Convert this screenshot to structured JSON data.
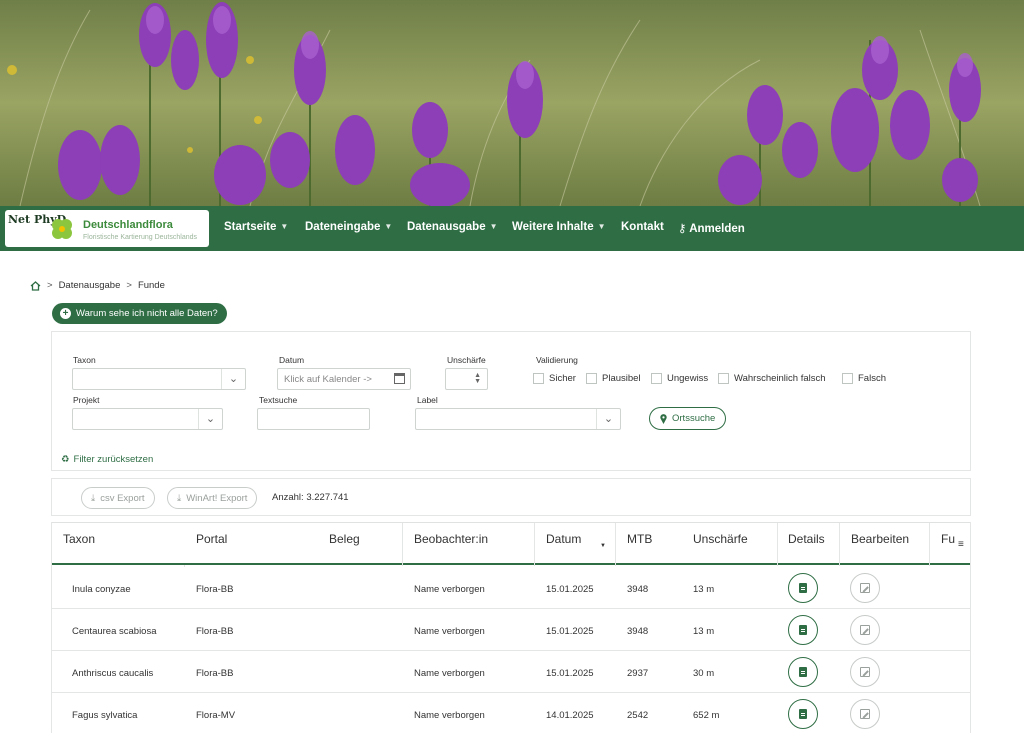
{
  "brand": {
    "badge": "Net PhyD",
    "title": "Deutschlandflora",
    "subtitle": "Floristische Kartierung Deutschlands"
  },
  "nav": {
    "items": [
      {
        "label": "Startseite"
      },
      {
        "label": "Dateneingabe"
      },
      {
        "label": "Datenausgabe"
      },
      {
        "label": "Weitere Inhalte"
      },
      {
        "label": "Kontakt"
      },
      {
        "label": "Anmelden"
      }
    ]
  },
  "breadcrumb": {
    "items": [
      "Datenausgabe",
      "Funde"
    ]
  },
  "why_button": "Warum sehe ich nicht alle Daten?",
  "filters": {
    "taxon_label": "Taxon",
    "datum_label": "Datum",
    "datum_placeholder": "Klick auf Kalender ->",
    "unschaerfe_label": "Unschärfe",
    "validierung_label": "Validierung",
    "validierung_options": [
      "Sicher",
      "Plausibel",
      "Ungewiss",
      "Wahrscheinlich falsch",
      "Falsch"
    ],
    "projekt_label": "Projekt",
    "textsuche_label": "Textsuche",
    "label_label": "Label",
    "ortssuche_button": "Ortssuche",
    "reset": "Filter zurücksetzen"
  },
  "export": {
    "csv": "csv Export",
    "winart": "WinArt! Export",
    "count": "Anzahl: 3.227.741"
  },
  "table": {
    "headers": [
      "Taxon",
      "Portal",
      "Beleg",
      "Beobachter:in",
      "Datum",
      "MTB",
      "Unschärfe",
      "Details",
      "Bearbeiten",
      "Fu"
    ],
    "rows": [
      {
        "taxon": "Inula conyzae",
        "portal": "Flora-BB",
        "beleg": "",
        "beobachter": "Name verborgen",
        "datum": "15.01.2025",
        "mtb": "3948",
        "unschaerfe": "13 m"
      },
      {
        "taxon": "Centaurea scabiosa",
        "portal": "Flora-BB",
        "beleg": "",
        "beobachter": "Name verborgen",
        "datum": "15.01.2025",
        "mtb": "3948",
        "unschaerfe": "13 m"
      },
      {
        "taxon": "Anthriscus caucalis",
        "portal": "Flora-BB",
        "beleg": "",
        "beobachter": "Name verborgen",
        "datum": "15.01.2025",
        "mtb": "2937",
        "unschaerfe": "30 m"
      },
      {
        "taxon": "Fagus sylvatica",
        "portal": "Flora-MV",
        "beleg": "",
        "beobachter": "Name verborgen",
        "datum": "14.01.2025",
        "mtb": "2542",
        "unschaerfe": "652 m"
      }
    ]
  },
  "colors": {
    "primary": "#2f6e45",
    "hero_flower": "#8c3fb6",
    "hero_grass": "#8d9a5a"
  }
}
